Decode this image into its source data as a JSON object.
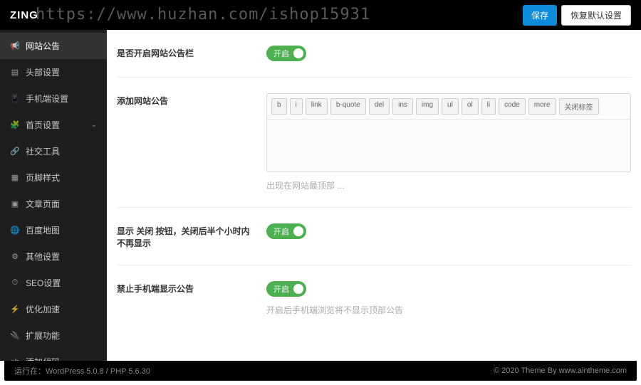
{
  "header": {
    "brand": "ZING",
    "watermark_url": "https://www.huzhan.com/ishop15931",
    "save_label": "保存",
    "reset_label": "恢复默认设置"
  },
  "sidebar": {
    "items": [
      {
        "icon": "megaphone",
        "label": "网站公告",
        "active": true
      },
      {
        "icon": "head",
        "label": "头部设置"
      },
      {
        "icon": "mobile",
        "label": "手机端设置"
      },
      {
        "icon": "puzzle",
        "label": "首页设置",
        "has_children": true
      },
      {
        "icon": "share",
        "label": "社交工具"
      },
      {
        "icon": "page",
        "label": "页脚样式"
      },
      {
        "icon": "grid",
        "label": "文章页面"
      },
      {
        "icon": "globe",
        "label": "百度地图"
      },
      {
        "icon": "gear",
        "label": "其他设置"
      },
      {
        "icon": "clock",
        "label": "SEO设置"
      },
      {
        "icon": "bolt",
        "label": "优化加速"
      },
      {
        "icon": "plugin",
        "label": "扩展功能"
      },
      {
        "icon": "code",
        "label": "添加代码"
      }
    ]
  },
  "icons": {
    "megaphone": "📢",
    "head": "▤",
    "mobile": "📱",
    "puzzle": "🧩",
    "share": "🔗",
    "page": "▦",
    "grid": "▣",
    "globe": "🌐",
    "gear": "⚙",
    "clock": "⏱",
    "bolt": "⚡",
    "plugin": "🔌",
    "code": "</>"
  },
  "main": {
    "notice_enable": {
      "label": "是否开启网站公告栏",
      "toggle_text": "开启"
    },
    "notice_add": {
      "label": "添加网站公告",
      "toolbar": [
        "b",
        "i",
        "link",
        "b-quote",
        "del",
        "ins",
        "img",
        "ul",
        "ol",
        "li",
        "code",
        "more",
        "关闭标签"
      ],
      "value": "",
      "hint": "出现在网站最顶部 ..."
    },
    "close_button": {
      "label": "显示 关闭 按钮，关闭后半个小时内不再显示",
      "toggle_text": "开启"
    },
    "mobile_hide": {
      "label": "禁止手机端显示公告",
      "toggle_text": "开启",
      "hint": "开启后手机端浏览将不显示顶部公告"
    }
  },
  "footer": {
    "left": "运行在：WordPress 5.0.8 / PHP 5.6.30",
    "right": "© 2020 Theme By www.aintheme.com"
  }
}
